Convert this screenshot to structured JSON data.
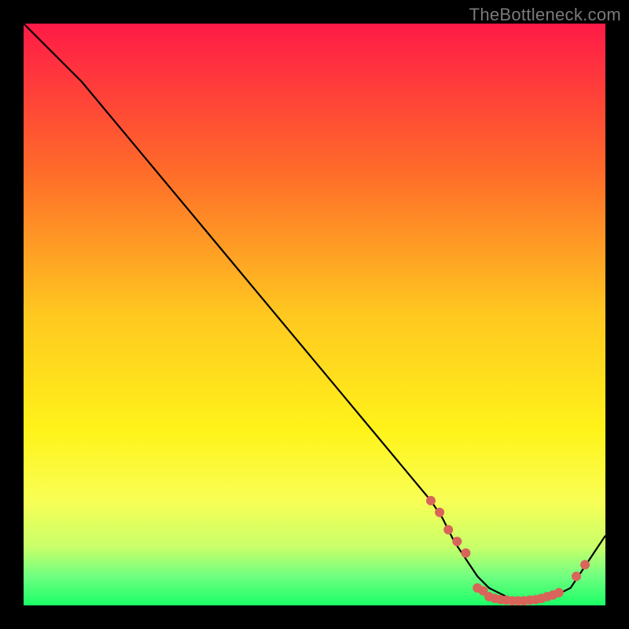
{
  "watermark": "TheBottleneck.com",
  "chart_data": {
    "type": "line",
    "title": "",
    "xlabel": "",
    "ylabel": "",
    "xlim": [
      0,
      100
    ],
    "ylim": [
      0,
      100
    ],
    "grid": false,
    "legend_position": "none",
    "background_gradient": {
      "stops": [
        {
          "offset": 0.0,
          "color": "#ff1a47"
        },
        {
          "offset": 0.25,
          "color": "#ff6a2a"
        },
        {
          "offset": 0.5,
          "color": "#ffc820"
        },
        {
          "offset": 0.7,
          "color": "#fff31a"
        },
        {
          "offset": 0.82,
          "color": "#f8ff55"
        },
        {
          "offset": 0.9,
          "color": "#c8ff6a"
        },
        {
          "offset": 0.95,
          "color": "#6fff80"
        },
        {
          "offset": 1.0,
          "color": "#1aff66"
        }
      ]
    },
    "series": [
      {
        "name": "bottleneck-curve",
        "color": "#000000",
        "x": [
          0,
          2,
          5,
          10,
          15,
          20,
          25,
          30,
          35,
          40,
          45,
          50,
          55,
          60,
          65,
          70,
          72,
          74,
          76,
          78,
          80,
          82,
          84,
          86,
          88,
          90,
          92,
          94,
          96,
          98,
          100
        ],
        "y": [
          100,
          98,
          95,
          90,
          84,
          78,
          72,
          66,
          60,
          54,
          48,
          42,
          36,
          30,
          24,
          18,
          15,
          11,
          8,
          5,
          3,
          2,
          1,
          1,
          1,
          1,
          2,
          3,
          6,
          9,
          12
        ]
      }
    ],
    "markers": [
      {
        "name": "descent-cluster",
        "color": "#d9645a",
        "x": [
          70,
          71.5,
          73,
          74.5,
          76
        ],
        "y": [
          18,
          16,
          13,
          11,
          9
        ]
      },
      {
        "name": "valley-cluster",
        "color": "#d9645a",
        "x": [
          78,
          79,
          80,
          81,
          82,
          83,
          84,
          85,
          86,
          87,
          88,
          89,
          90,
          91,
          92
        ],
        "y": [
          3,
          2.5,
          1.5,
          1.2,
          1.0,
          0.9,
          0.8,
          0.8,
          0.8,
          0.9,
          1.0,
          1.2,
          1.5,
          1.8,
          2.2
        ]
      },
      {
        "name": "ascent-cluster",
        "color": "#d9645a",
        "x": [
          95,
          96.5
        ],
        "y": [
          5,
          7
        ]
      }
    ]
  }
}
